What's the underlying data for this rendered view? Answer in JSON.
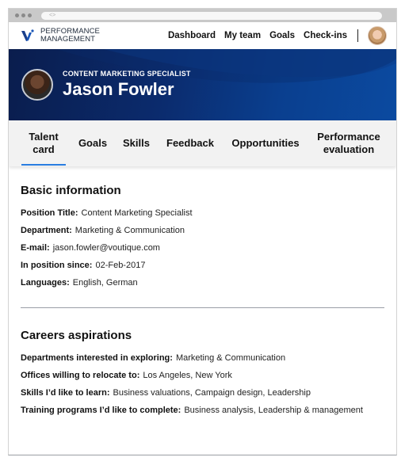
{
  "browser": {
    "url_placeholder": "<>"
  },
  "topnav": {
    "logo_line1": "PERFORMANCE",
    "logo_line2": "MANAGEMENT",
    "links": [
      {
        "label": "Dashboard"
      },
      {
        "label": "My team"
      },
      {
        "label": "Goals"
      },
      {
        "label": "Check-ins"
      }
    ],
    "user_avatar_icon": "user-avatar"
  },
  "profile": {
    "role": "CONTENT MARKETING SPECIALIST",
    "name": "Jason Fowler"
  },
  "tabs": [
    {
      "label": "Talent card",
      "active": true
    },
    {
      "label": "Goals",
      "active": false
    },
    {
      "label": "Skills",
      "active": false
    },
    {
      "label": "Feedback",
      "active": false
    },
    {
      "label": "Opportunities",
      "active": false
    },
    {
      "label": "Performance evaluation",
      "active": false
    }
  ],
  "basic_information": {
    "title": "Basic information",
    "fields": [
      {
        "label": "Position Title:",
        "value": "Content Marketing Specialist"
      },
      {
        "label": "Department:",
        "value": "Marketing & Communication"
      },
      {
        "label": "E-mail:",
        "value": "jason.fowler@voutique.com"
      },
      {
        "label": "In position since:",
        "value": "02-Feb-2017"
      },
      {
        "label": "Languages:",
        "value": "English, German"
      }
    ]
  },
  "career_aspirations": {
    "title": "Careers aspirations",
    "fields": [
      {
        "label": "Departments interested in exploring:",
        "value": "Marketing & Communication"
      },
      {
        "label": "Offices willing to relocate to:",
        "value": "Los Angeles, New York"
      },
      {
        "label": "Skills I’d like to learn:",
        "value": "Business valuations, Campaign design, Leadership"
      },
      {
        "label": "Training programs I’d like to complete:",
        "value": "Business analysis, Leadership & management"
      }
    ]
  },
  "colors": {
    "accent": "#2a7de1",
    "hero_dark": "#0a1d4d",
    "hero_light": "#0b4aa0"
  }
}
